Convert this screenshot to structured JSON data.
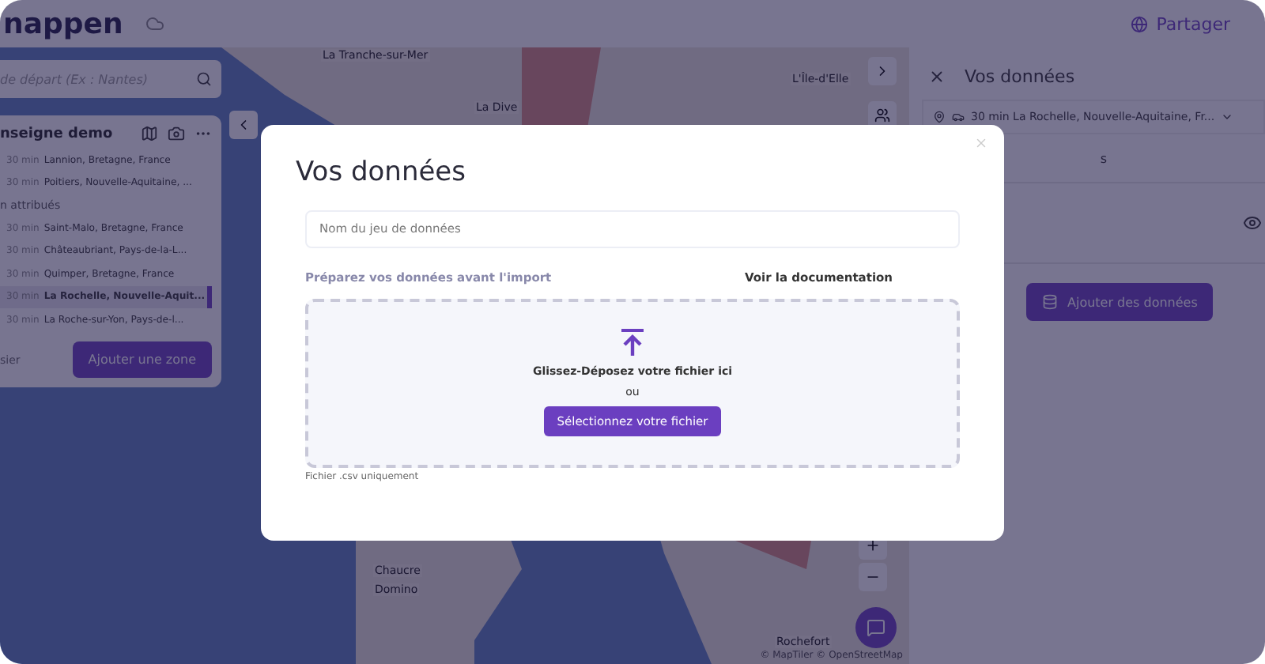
{
  "header": {
    "logo": "nappen",
    "share": "Partager"
  },
  "search": {
    "placeholder": "de départ (Ex : Nantes)"
  },
  "zones": {
    "title": "nseigne demo",
    "groups": [
      {
        "rows": [
          {
            "time": "30 min",
            "place": "Lannion, Bretagne, France",
            "selected": false
          },
          {
            "time": "30 min",
            "place": "Poitiers, Nouvelle-Aquitaine, ...",
            "selected": false
          }
        ]
      },
      {
        "label": "n attribués",
        "rows": [
          {
            "time": "30 min",
            "place": "Saint-Malo, Bretagne, France",
            "selected": false
          },
          {
            "time": "30 min",
            "place": "Châteaubriant, Pays-de-la-L...",
            "selected": false
          },
          {
            "time": "30 min",
            "place": "Quimper, Bretagne, France",
            "selected": false
          },
          {
            "time": "30 min",
            "place": "La Rochelle, Nouvelle-Aquit...",
            "selected": true
          },
          {
            "time": "30 min",
            "place": "La Roche-sur-Yon, Pays-de-l...",
            "selected": false
          }
        ]
      }
    ],
    "footer_link": "sier",
    "add_button": "Ajouter une zone"
  },
  "map": {
    "labels": [
      "La Tranche-sur-Mer",
      "La Dive",
      "L'Île-d'Elle",
      "Chaucre",
      "Domino",
      "Rochefort"
    ],
    "attribution": "© MapTiler © OpenStreetMap"
  },
  "right_panel": {
    "title": "Vos données",
    "zone_select": "30 min La Rochelle, Nouvelle-Aquitaine, Fr...",
    "tab": "s",
    "add_button": "Ajouter des données"
  },
  "modal": {
    "title": "Vos données",
    "name_field": {
      "placeholder": "Nom du jeu de données"
    },
    "prepare_link": "Préparez vos données avant l'import",
    "doc_link": "Voir la documentation",
    "drop_text": "Glissez-Déposez votre fichier ici",
    "or": "ou",
    "select_button": "Sélectionnez votre fichier",
    "note": "Fichier .csv uniquement"
  }
}
